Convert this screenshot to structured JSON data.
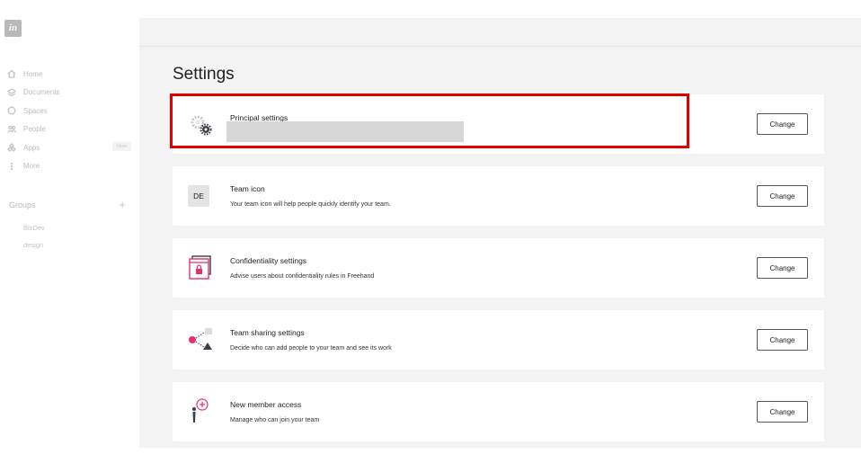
{
  "app": {
    "logo_text": "in"
  },
  "sidebar": {
    "items": [
      {
        "label": "Home",
        "icon": "home-icon"
      },
      {
        "label": "Documents",
        "icon": "layers-icon"
      },
      {
        "label": "Spaces",
        "icon": "circle-icon"
      },
      {
        "label": "People",
        "icon": "people-icon"
      },
      {
        "label": "Apps",
        "icon": "apps-icon",
        "badge": "New"
      },
      {
        "label": "More",
        "icon": "more-icon"
      }
    ],
    "groups_title": "Groups",
    "groups_add": "+",
    "groups": [
      "BizDev",
      "design"
    ]
  },
  "main": {
    "title": "Settings",
    "cards": [
      {
        "title": "Principal settings",
        "desc": "",
        "button": "Change",
        "icon": "gears-icon"
      },
      {
        "title": "Team icon",
        "desc": "Your team icon will help people quickly identify your team.",
        "button": "Change",
        "icon": "team-badge",
        "badge_text": "DE"
      },
      {
        "title": "Confidentiality settings",
        "desc": "Advise users about confidentiality rules in Freehand",
        "button": "Change",
        "icon": "lock-window-icon"
      },
      {
        "title": "Team sharing settings",
        "desc": "Decide who can add people to your team and see its work",
        "button": "Change",
        "icon": "share-icon"
      },
      {
        "title": "New member access",
        "desc": "Manage who can join your team",
        "button": "Change",
        "icon": "add-member-icon"
      }
    ]
  },
  "colors": {
    "accent": "#e8306a",
    "highlight": "#e00000",
    "background": "#f3f3f3"
  }
}
